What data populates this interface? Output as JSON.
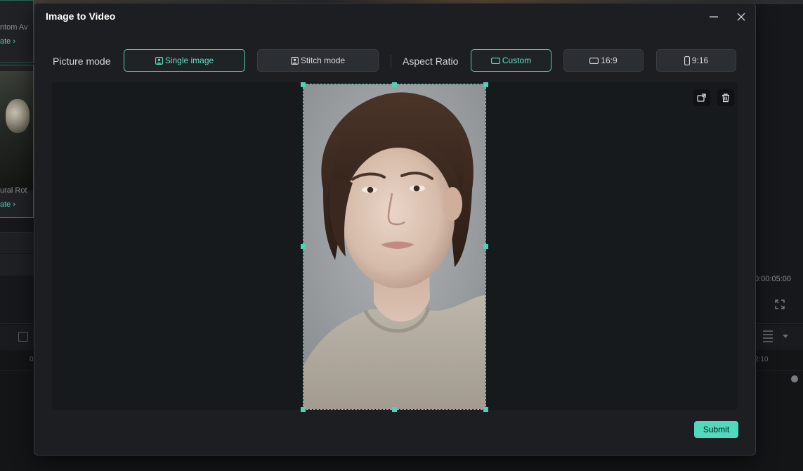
{
  "background": {
    "card1": {
      "title": "ntom Av",
      "link": "ate"
    },
    "card2": {
      "title": "ural Rot",
      "link": "ate"
    },
    "time_readout": "0:00:05:00",
    "ruler_ticks": [
      "0",
      "2:10"
    ]
  },
  "dialog": {
    "title": "Image to Video",
    "picture_mode": {
      "label": "Picture mode",
      "options": [
        "Single image",
        "Stitch mode"
      ],
      "selected": "Single image"
    },
    "aspect_ratio": {
      "label": "Aspect Ratio",
      "options": [
        "Custom",
        "16:9",
        "9:16"
      ],
      "selected": "Custom"
    },
    "submit_label": "Submit",
    "icons": {
      "minimize": "minimize-icon",
      "close": "close-icon",
      "replace": "replace-image-icon",
      "delete": "trash-icon"
    },
    "accent_color": "#4fd1b8"
  }
}
